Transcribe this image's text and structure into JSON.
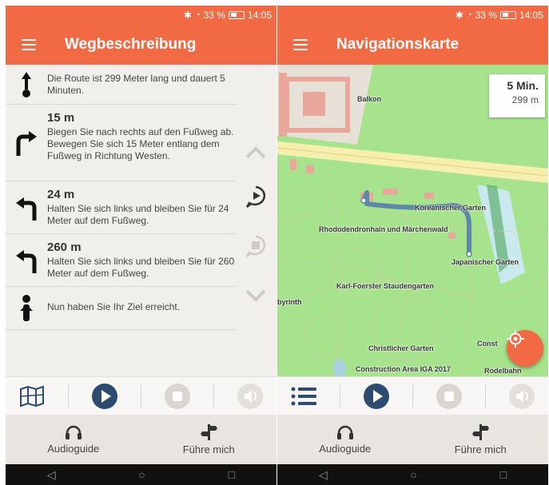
{
  "status": {
    "battery": "33 %",
    "time": "14:05"
  },
  "left": {
    "title": "Wegbeschreibung",
    "directions": [
      {
        "distance": "",
        "text": "Die Route ist 299 Meter lang und dauert 5 Minuten.",
        "icon": "start-marker-icon"
      },
      {
        "distance": "15 m",
        "text": "Biegen Sie nach rechts auf den Fußweg ab. Bewegen Sie sich 15 Meter entlang dem Fußweg in Richtung Westen.",
        "icon": "turn-right-icon"
      },
      {
        "distance": "24 m",
        "text": "Halten Sie sich links und bleiben Sie für 24 Meter auf dem Fußweg.",
        "icon": "turn-left-icon"
      },
      {
        "distance": "260 m",
        "text": "Halten Sie sich links und bleiben Sie für 260 Meter auf dem Fußweg.",
        "icon": "turn-left-icon"
      },
      {
        "distance": "",
        "text": "Nun haben Sie Ihr Ziel erreicht.",
        "icon": "destination-person-icon"
      }
    ]
  },
  "right": {
    "title": "Navigationskarte",
    "time_box": {
      "minutes": "5 Min.",
      "meters": "299 m"
    },
    "map_labels": {
      "balkon": "Balkon",
      "koreanischer": "Koreanischer Garten",
      "rhododendron": "Rhododendronhain und Märchenwald",
      "japanischer": "Japanischer Garten",
      "foerster": "Karl-Foerster Staudengarten",
      "labyrinth": "byrinth",
      "christlicher": "Christlicher Garten",
      "construction": "Construction Area IGA 2017",
      "const": "Const",
      "rodelbahn": "Rodelbahn"
    }
  },
  "bottom_nav": {
    "audioguide": "Audioguide",
    "fuehre_mich": "Führe mich"
  },
  "colors": {
    "accent": "#f26a43",
    "dark_blue": "#2d4b6e",
    "route": "#5e87a8"
  }
}
